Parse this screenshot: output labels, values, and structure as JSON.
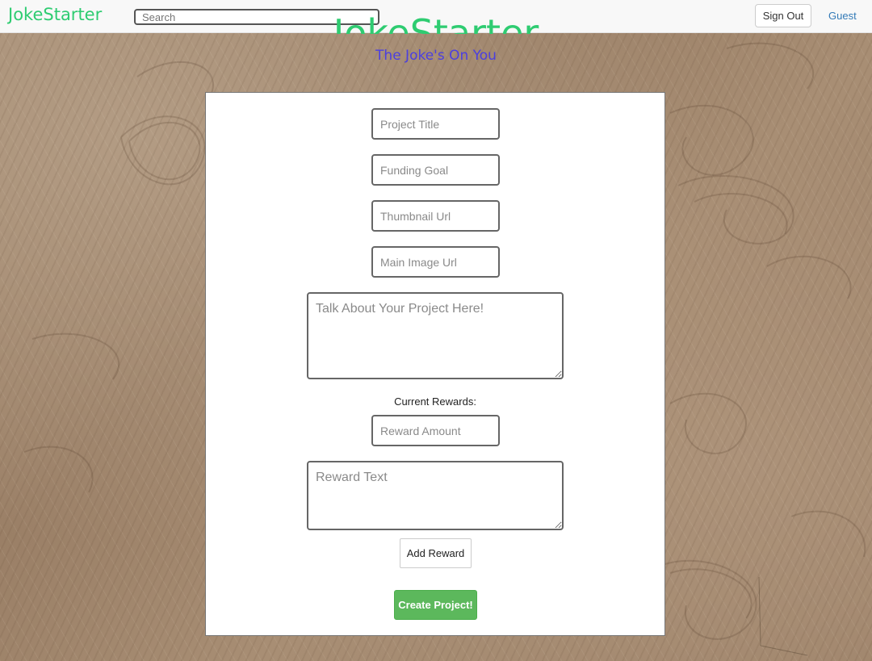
{
  "navbar": {
    "brand": "JokeStarter",
    "search_placeholder": "Search",
    "sign_out_label": "Sign Out",
    "user_link": "Guest"
  },
  "hero": {
    "title": "JokeStarter",
    "tagline": "The Joke's On You"
  },
  "form": {
    "project_title_placeholder": "Project Title",
    "funding_goal_placeholder": "Funding Goal",
    "thumbnail_url_placeholder": "Thumbnail Url",
    "main_image_url_placeholder": "Main Image Url",
    "description_placeholder": "Talk About Your Project Here!",
    "current_rewards_label": "Current Rewards:",
    "reward_amount_placeholder": "Reward Amount",
    "reward_text_placeholder": "Reward Text",
    "add_reward_label": "Add Reward",
    "create_project_label": "Create Project!"
  },
  "colors": {
    "brand_green": "#2ecc71",
    "tagline_blue": "#4b3fe0",
    "success_green": "#5cb85c",
    "link_blue": "#337ab7"
  }
}
